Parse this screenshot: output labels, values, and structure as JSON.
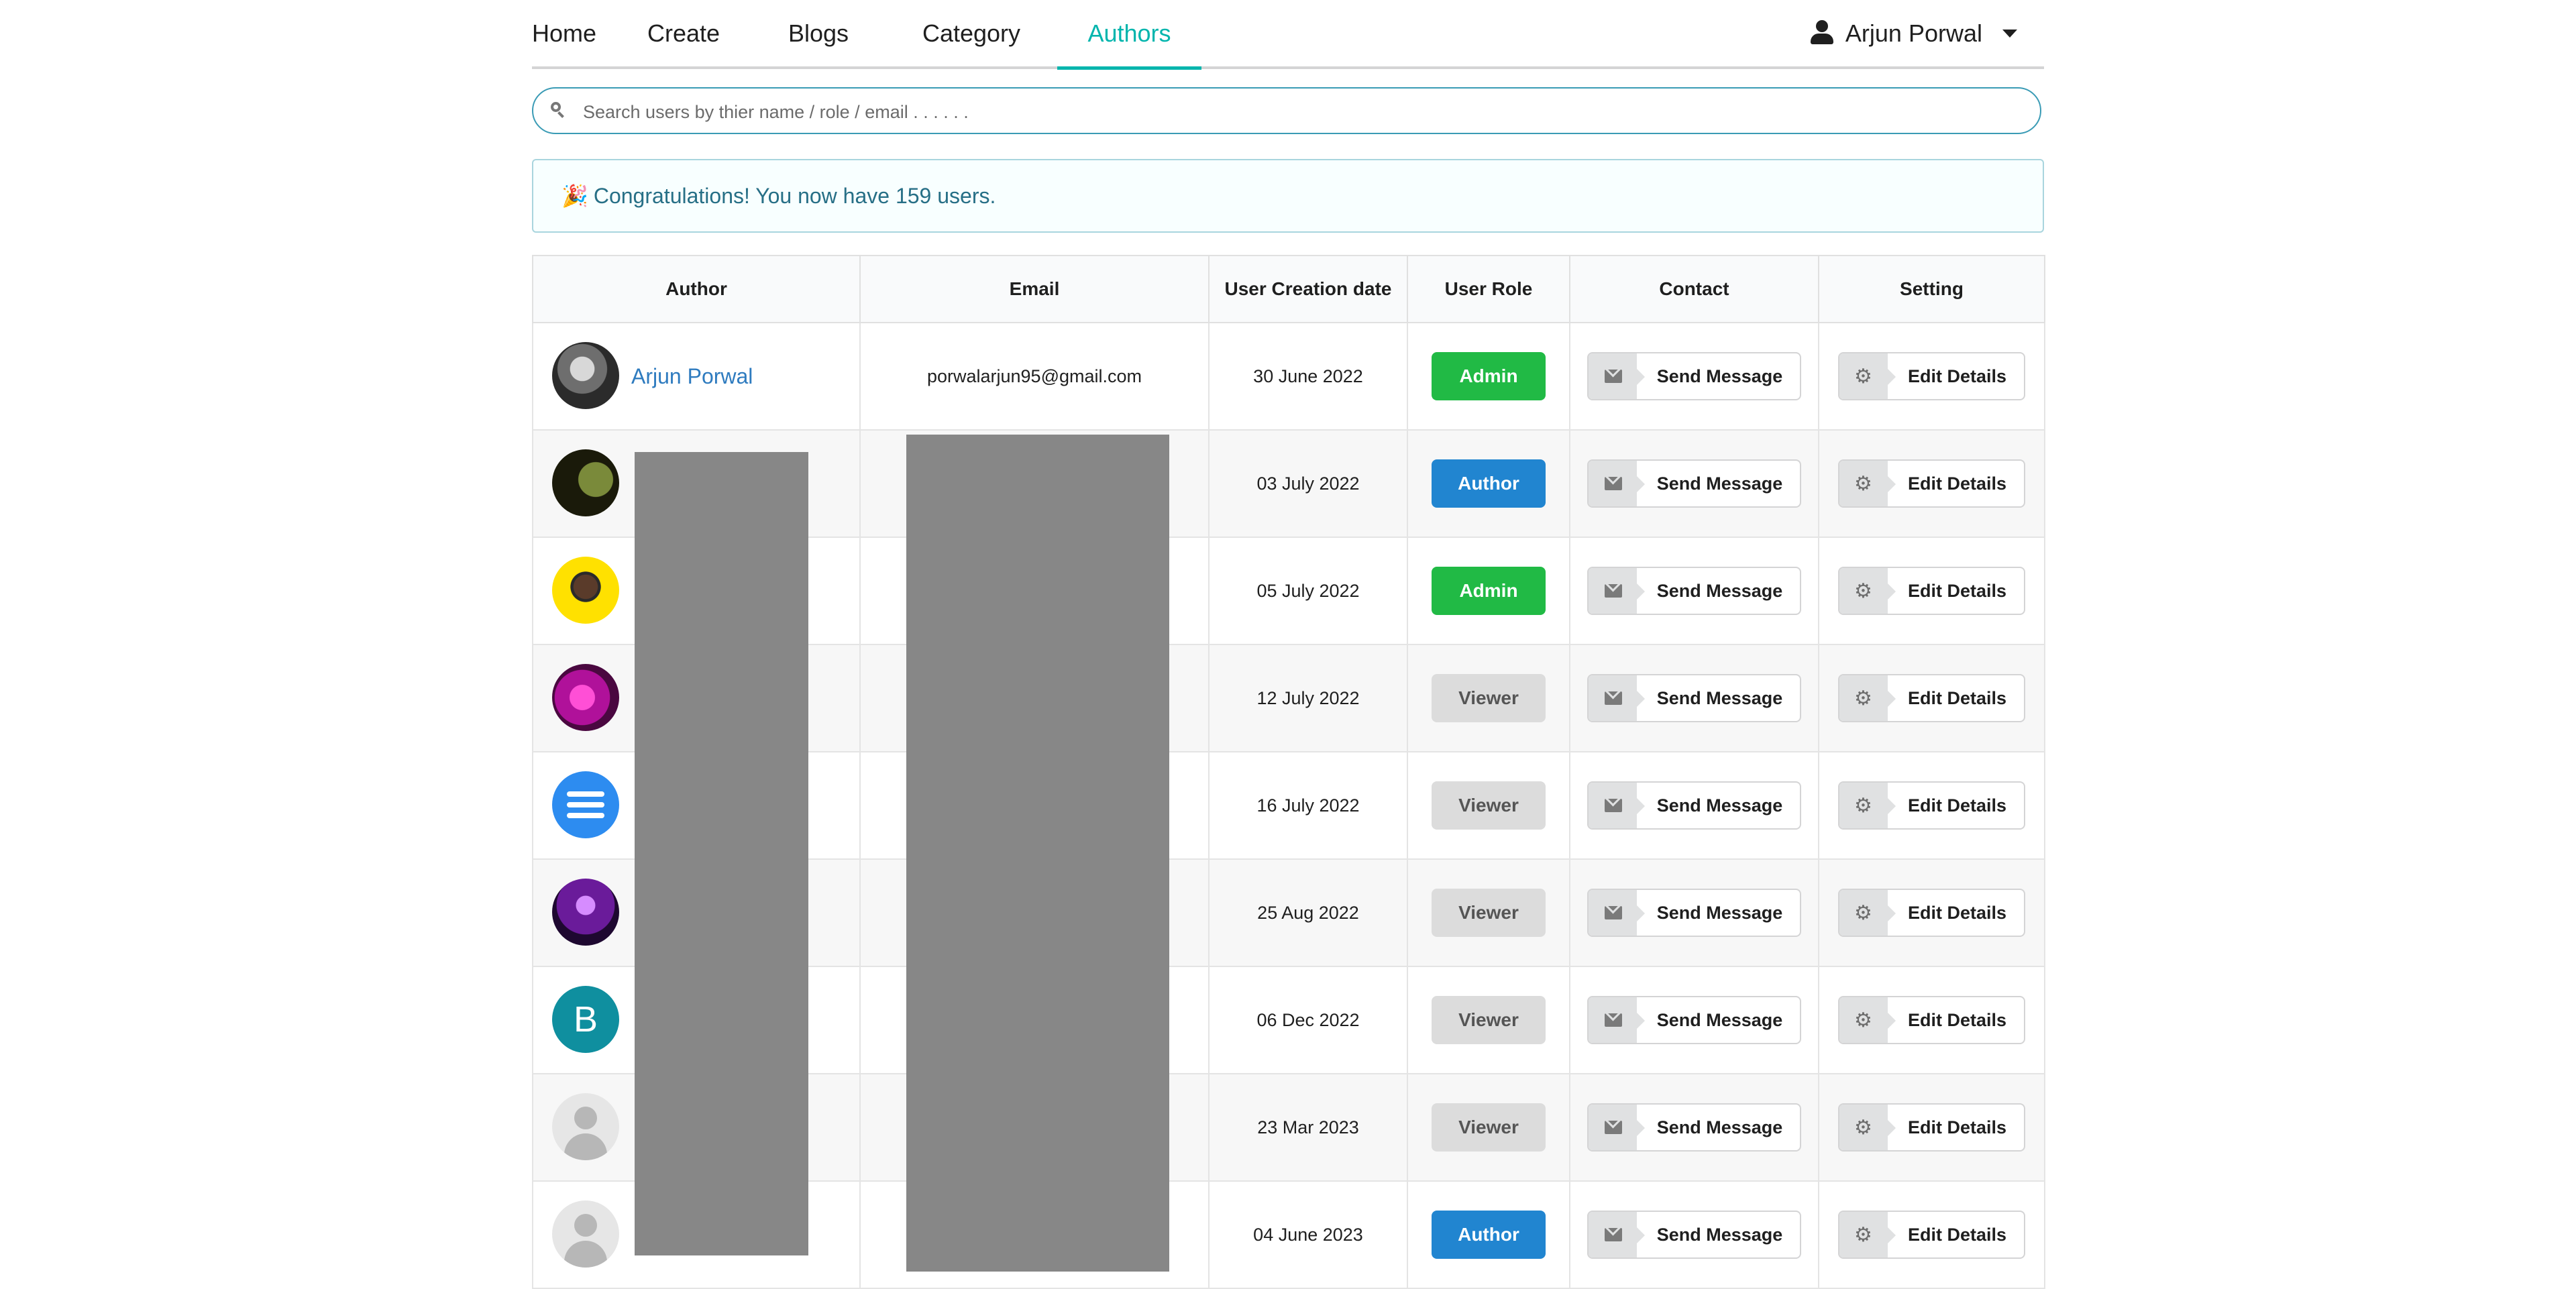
{
  "nav": {
    "items": [
      "Home",
      "Create",
      "Blogs",
      "Category",
      "Authors"
    ],
    "active": "Authors",
    "user_name": "Arjun Porwal"
  },
  "search": {
    "placeholder": "Search users by thier name / role / email . . . . . ."
  },
  "message": {
    "emoji": "🎉",
    "text": "Congratulations! You now have 159 users."
  },
  "table": {
    "headers": [
      "Author",
      "Email",
      "User Creation date",
      "User Role",
      "Contact",
      "Setting"
    ],
    "rows": [
      {
        "name": "Arjun Porwal",
        "email": "porwalarjun95@gmail.com",
        "date": "30 June 2022",
        "role": "Admin",
        "avatar": "photo-dark"
      },
      {
        "name": "",
        "email": "",
        "date": "03 July 2022",
        "role": "Author",
        "avatar": "photo-green"
      },
      {
        "name": "",
        "email": "",
        "date": "05 July 2022",
        "role": "Admin",
        "avatar": "photo-yellow"
      },
      {
        "name": "",
        "email": "",
        "date": "12 July 2022",
        "role": "Viewer",
        "avatar": "photo-magenta"
      },
      {
        "name": "",
        "email": "",
        "date": "16 July 2022",
        "role": "Viewer",
        "avatar": "list-icon-blue"
      },
      {
        "name": "",
        "email": "",
        "date": "25 Aug 2022",
        "role": "Viewer",
        "avatar": "photo-purple"
      },
      {
        "name": "",
        "email": "",
        "date": "06 Dec 2022",
        "role": "Viewer",
        "avatar": "letter-B"
      },
      {
        "name": "",
        "email": "",
        "date": "23 Mar 2023",
        "role": "Viewer",
        "avatar": "default-user"
      },
      {
        "name": "",
        "email": "",
        "date": "04 June 2023",
        "role": "Author",
        "avatar": "default-user"
      }
    ],
    "contact_label": "Send Message",
    "setting_label": "Edit Details",
    "avatar_letter": "B"
  },
  "colors": {
    "accent": "#00b5ad",
    "admin": "#21ba45",
    "author": "#2185d0",
    "viewer": "#dcdcdc",
    "link": "#2e7bbf"
  }
}
